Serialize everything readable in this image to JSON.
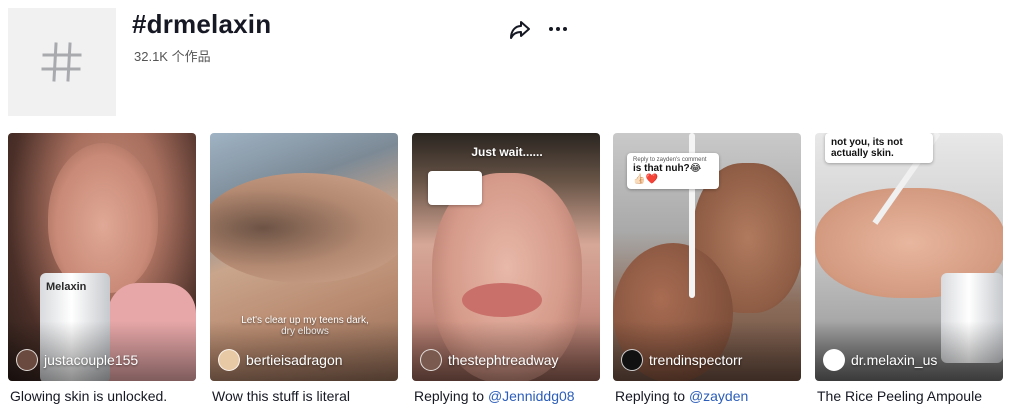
{
  "hashtag": {
    "title": "#drmelaxin",
    "count": "32.1K",
    "count_suffix": "个作品"
  },
  "videos": [
    {
      "username": "justacouple155",
      "caption": "Glowing skin is unlocked.",
      "bottle_label": "Melaxin"
    },
    {
      "username": "bertieisadragon",
      "caption": "Wow this stuff is literal",
      "overlay": "Let's clear up my teens dark, dry elbows"
    },
    {
      "username": "thestephtreadway",
      "caption_prefix": "Replying to",
      "caption_mention": "@Jenniddg08",
      "overlay_top": "Just wait......"
    },
    {
      "username": "trendinspectorr",
      "caption_prefix": "Replying to",
      "caption_mention": "@zayden",
      "bubble_small": "Reply to zayden's comment",
      "bubble_text": "is that nuh?😂👍🏻❤️"
    },
    {
      "username": "dr.melaxin_us",
      "caption": "The Rice Peeling Ampoule",
      "bubble_text": "not you, its not actually skin."
    }
  ]
}
